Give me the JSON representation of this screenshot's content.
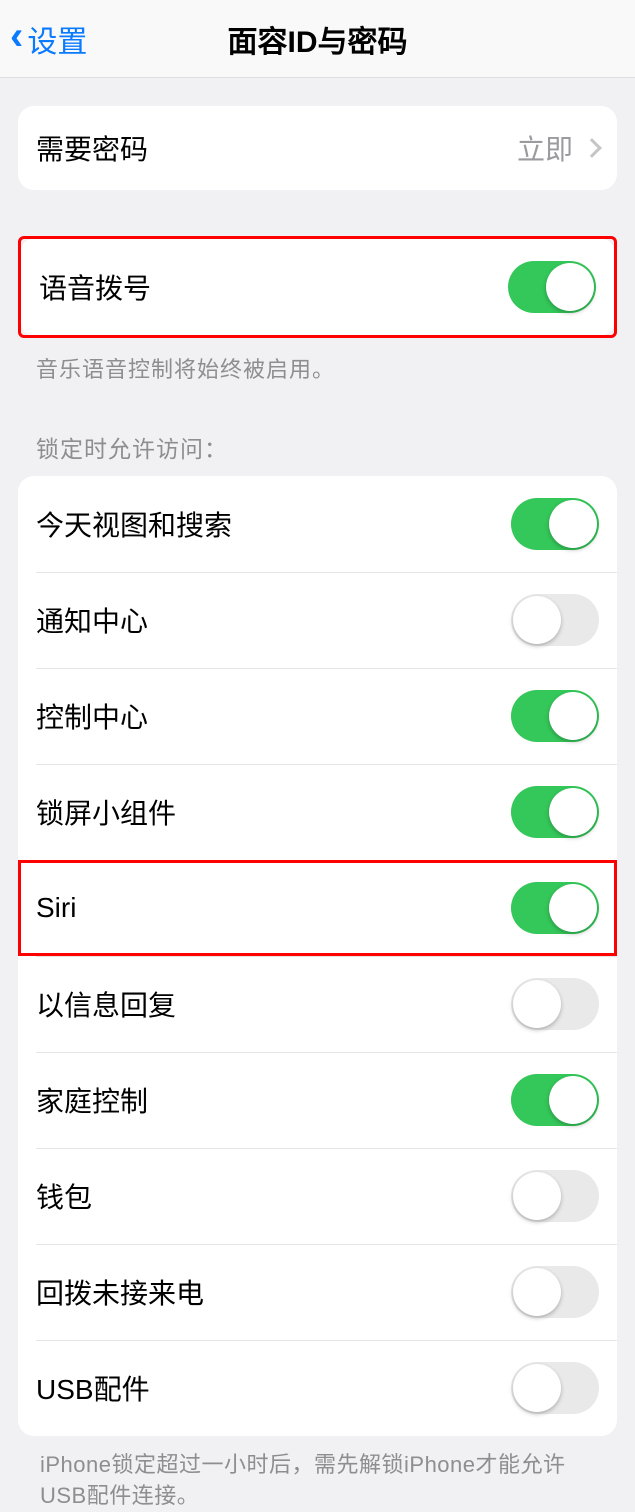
{
  "header": {
    "back_label": "设置",
    "title": "面容ID与密码"
  },
  "require_passcode": {
    "label": "需要密码",
    "value": "立即"
  },
  "voice_dial": {
    "label": "语音拨号",
    "on": true,
    "hint": "音乐语音控制将始终被启用。"
  },
  "lock_access": {
    "section_label": "锁定时允许访问：",
    "items": [
      {
        "label": "今天视图和搜索",
        "on": true
      },
      {
        "label": "通知中心",
        "on": false
      },
      {
        "label": "控制中心",
        "on": true
      },
      {
        "label": "锁屏小组件",
        "on": true
      },
      {
        "label": "Siri",
        "on": true,
        "highlighted": true
      },
      {
        "label": "以信息回复",
        "on": false
      },
      {
        "label": "家庭控制",
        "on": true
      },
      {
        "label": "钱包",
        "on": false
      },
      {
        "label": "回拨未接来电",
        "on": false
      },
      {
        "label": "USB配件",
        "on": false
      }
    ],
    "footer_hint": "iPhone锁定超过一小时后，需先解锁iPhone才能允许USB配件连接。"
  }
}
